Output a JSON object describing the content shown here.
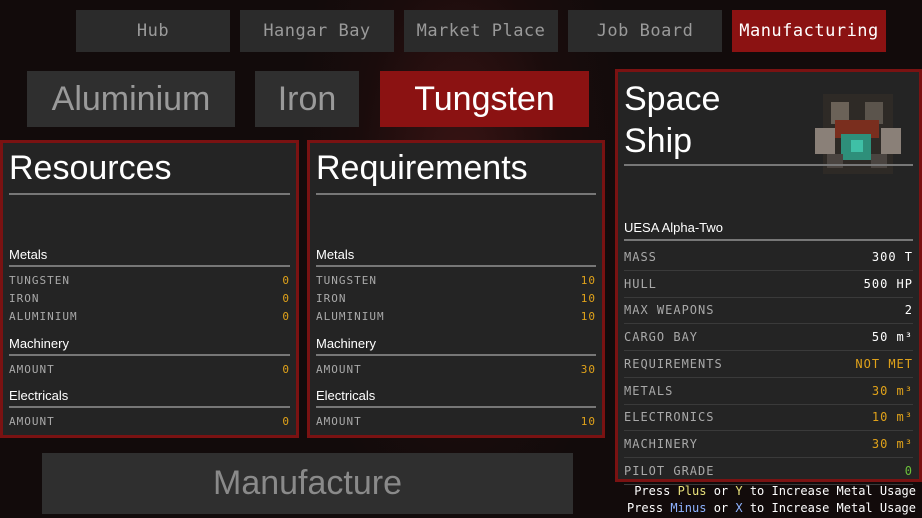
{
  "nav": {
    "tabs": [
      "Hub",
      "Hangar Bay",
      "Market Place",
      "Job Board",
      "Manufacturing"
    ],
    "active_index": 4
  },
  "metals": {
    "tabs": [
      "Aluminium",
      "Iron",
      "Tungsten"
    ],
    "active_index": 2
  },
  "resources": {
    "title": "Resources",
    "metals_label": "Metals",
    "metals": [
      {
        "name": "TUNGSTEN",
        "value": "0"
      },
      {
        "name": "IRON",
        "value": "0"
      },
      {
        "name": "ALUMINIUM",
        "value": "0"
      }
    ],
    "machinery_label": "Machinery",
    "machinery_amount_label": "AMOUNT",
    "machinery_amount": "0",
    "electricals_label": "Electricals",
    "electricals_amount_label": "AMOUNT",
    "electricals_amount": "0"
  },
  "requirements": {
    "title": "Requirements",
    "metals_label": "Metals",
    "metals": [
      {
        "name": "TUNGSTEN",
        "value": "10"
      },
      {
        "name": "IRON",
        "value": "10"
      },
      {
        "name": "ALUMINIUM",
        "value": "10"
      }
    ],
    "machinery_label": "Machinery",
    "machinery_amount_label": "AMOUNT",
    "machinery_amount": "30",
    "electricals_label": "Electricals",
    "electricals_amount_label": "AMOUNT",
    "electricals_amount": "10"
  },
  "ship": {
    "title_line1": "Space",
    "title_line2": "Ship",
    "name": "UESA Alpha-Two",
    "stats": [
      {
        "label": "MASS",
        "value": "300 T",
        "style": "normal"
      },
      {
        "label": "HULL",
        "value": "500 HP",
        "style": "normal"
      },
      {
        "label": "MAX WEAPONS",
        "value": "2",
        "style": "normal"
      },
      {
        "label": "CARGO BAY",
        "value": "50 m³",
        "style": "normal"
      },
      {
        "label": "REQUIREMENTS",
        "value": "NOT MET",
        "style": "warn"
      },
      {
        "label": "METALS",
        "value": "30 m³",
        "style": "warn"
      },
      {
        "label": "ELECTRONICS",
        "value": "10 m³",
        "style": "warn"
      },
      {
        "label": "MACHINERY",
        "value": "30 m³",
        "style": "warn"
      },
      {
        "label": "PILOT GRADE",
        "value": "0",
        "style": "ok"
      }
    ]
  },
  "manufacture_button": "Manufacture",
  "hints": {
    "line1": {
      "pre": "Press ",
      "a": "Plus",
      "mid": " or ",
      "b": "Y",
      "post": " to Increase Metal Usage"
    },
    "line2": {
      "pre": "Press ",
      "a": "Minus",
      "mid": " or ",
      "b": "X",
      "post": " to Increase Metal Usage"
    }
  },
  "colors": {
    "accent_red": "#8b1212",
    "panel_border": "#7a1212",
    "value_orange": "#e0a21a",
    "value_green": "#6bbf3a"
  }
}
